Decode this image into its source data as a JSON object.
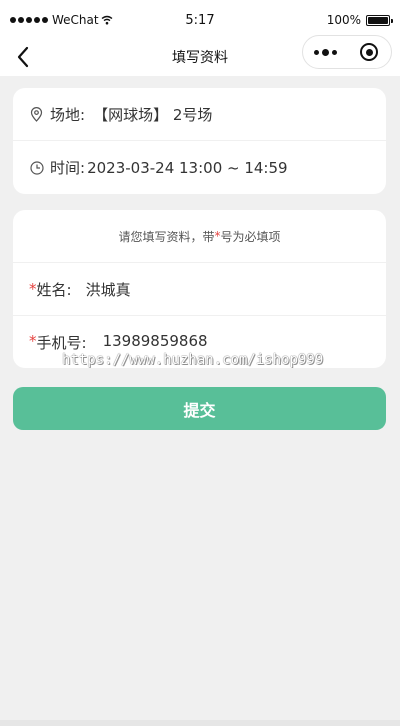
{
  "status_bar": {
    "carrier": "WeChat",
    "time": "5:17",
    "battery": "100%"
  },
  "nav": {
    "title": "填写资料"
  },
  "booking": {
    "venue_label": "场地:",
    "venue_value": "【网球场】 2号场",
    "time_label": "时间:",
    "time_value": "2023-03-24 13:00 ~ 14:59"
  },
  "form": {
    "hint_prefix": "请您填写资料，带",
    "hint_star": "*",
    "hint_suffix": "号为必填项",
    "name_star": "*",
    "name_label": "姓名:",
    "name_value": "洪城真",
    "phone_star": "*",
    "phone_label": "手机号:",
    "phone_value": "13989859868"
  },
  "watermark": "https://www.huzhan.com/ishop999",
  "submit_label": "提交",
  "colors": {
    "accent": "#58bf98",
    "required": "#e64340",
    "background": "#f0f0f0"
  }
}
